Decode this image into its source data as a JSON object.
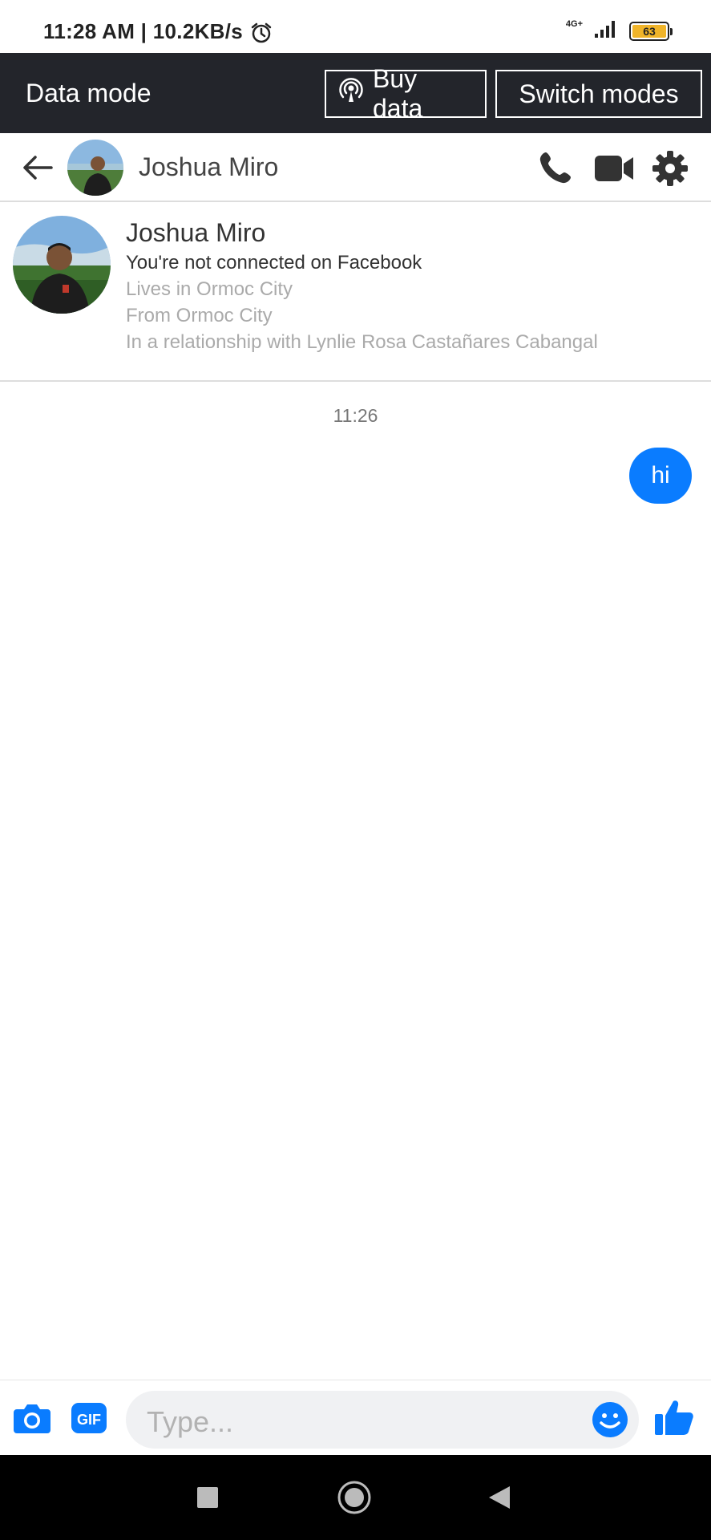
{
  "status_bar": {
    "time": "11:28 AM | 10.2KB/s",
    "network": "4G+",
    "battery": "63",
    "icons": [
      "alarm-icon",
      "signal-icon",
      "battery-icon"
    ]
  },
  "data_bar": {
    "title": "Data mode",
    "buy_label": "Buy data",
    "switch_label": "Switch modes"
  },
  "header": {
    "name": "Joshua Miro",
    "icons": [
      "back-arrow-icon",
      "phone-icon",
      "video-camera-icon",
      "gear-icon"
    ]
  },
  "profile": {
    "name": "Joshua Miro",
    "connection": "You're not connected on Facebook",
    "lives": "Lives in Ormoc City",
    "from": "From Ormoc City",
    "relationship": "In a relationship with Lynlie Rosa Castañares Cabangal"
  },
  "conversation": {
    "timestamp": "11:26",
    "messages": [
      {
        "from": "me",
        "text": "hi"
      }
    ]
  },
  "composer": {
    "placeholder": "Type...",
    "gif_label": "GIF",
    "icons": [
      "camera-icon",
      "gif-icon",
      "emoji-icon",
      "thumbs-up-icon"
    ]
  },
  "colors": {
    "accent": "#0a7cff",
    "databar": "#23252b",
    "battery": "#f0b429"
  }
}
